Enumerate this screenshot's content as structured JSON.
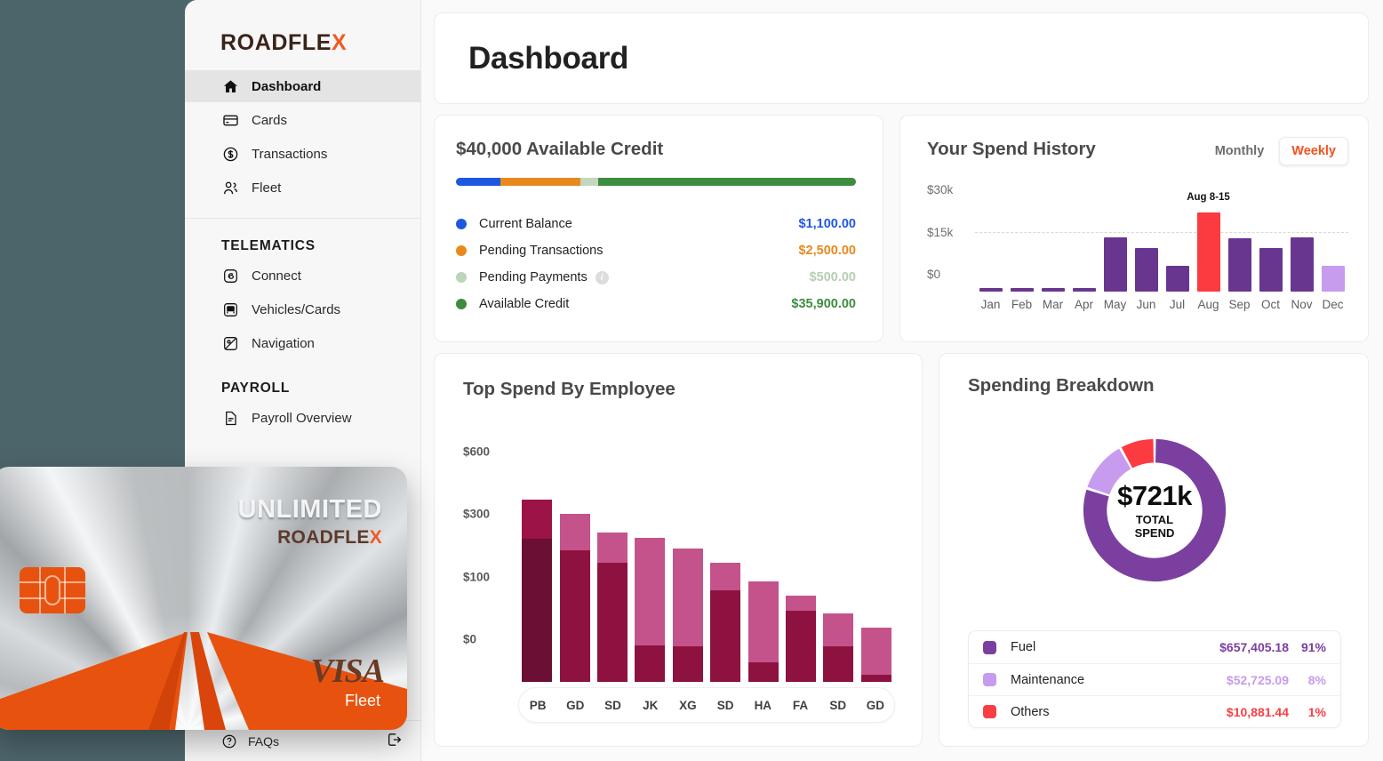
{
  "brand": {
    "name_main": "ROADFLE",
    "name_accent": "X",
    "accent_color": "#f05a22"
  },
  "sidebar": {
    "nav": [
      {
        "label": "Dashboard",
        "icon": "home-icon",
        "active": true
      },
      {
        "label": "Cards",
        "icon": "credit-card-icon",
        "active": false
      },
      {
        "label": "Transactions",
        "icon": "dollar-circle-icon",
        "active": false
      },
      {
        "label": "Fleet",
        "icon": "people-icon",
        "active": false
      }
    ],
    "groups": [
      {
        "title": "TELEMATICS",
        "items": [
          {
            "label": "Connect",
            "icon": "connect-icon"
          },
          {
            "label": "Vehicles/Cards",
            "icon": "bus-icon"
          },
          {
            "label": "Navigation",
            "icon": "navigation-icon"
          }
        ]
      },
      {
        "title": "PAYROLL",
        "items": [
          {
            "label": "Payroll Overview",
            "icon": "document-icon"
          }
        ]
      }
    ],
    "footer": {
      "faqs_label": "FAQs",
      "faqs_icon": "question-circle-icon",
      "logout_icon": "logout-icon"
    }
  },
  "header": {
    "title": "Dashboard"
  },
  "credit": {
    "title": "$40,000 Available Credit",
    "bar": [
      {
        "color": "#1f58e0",
        "pct": 11.0
      },
      {
        "color": "#e8891e",
        "pct": 20.0
      },
      {
        "color": "#c3d6c0",
        "pct": 4.5
      },
      {
        "color": "#3e8c3f",
        "pct": 64.5
      }
    ],
    "rows": [
      {
        "label": "Current Balance",
        "amount": "$1,100.00",
        "color": "#1f58e0",
        "info": false
      },
      {
        "label": "Pending Transactions",
        "amount": "$2,500.00",
        "color": "#e8891e",
        "info": false
      },
      {
        "label": "Pending Payments",
        "amount": "$500.00",
        "color": "#bcd4b8",
        "info": true
      },
      {
        "label": "Available Credit",
        "amount": "$35,900.00",
        "color": "#3e8c3f",
        "info": false
      }
    ]
  },
  "spend_history": {
    "title": "Your Spend History",
    "toggle": {
      "monthly": "Monthly",
      "weekly": "Weekly",
      "selected": "Weekly"
    }
  },
  "employee_spend": {
    "title": "Top Spend By Employee"
  },
  "breakdown": {
    "title": "Spending Breakdown",
    "total": "$721k",
    "total_label_line1": "TOTAL",
    "total_label_line2": "SPEND",
    "legend": [
      {
        "label": "Fuel",
        "amount": "$657,405.18",
        "pct": "91%",
        "color": "#7b3fa0"
      },
      {
        "label": "Maintenance",
        "amount": "$52,725.09",
        "pct": "8%",
        "color": "#c79bee"
      },
      {
        "label": "Others",
        "amount": "$10,881.44",
        "pct": "1%",
        "color": "#f93f43"
      }
    ]
  },
  "visa_card": {
    "unlimited": "UNLIMITED",
    "brand_main": "ROADFLE",
    "brand_accent": "X",
    "network": "VISA",
    "product": "Fleet"
  },
  "chart_data": [
    {
      "type": "bar",
      "title": "Your Spend History",
      "xlabel": "",
      "ylabel": "",
      "ylim": [
        0,
        33000
      ],
      "yticks": [
        0,
        15000,
        30000
      ],
      "ytick_labels": [
        "$0",
        "$15k",
        "$30k"
      ],
      "grid": true,
      "categories": [
        "Jan",
        "Feb",
        "Mar",
        "Apr",
        "May",
        "Jun",
        "Jul",
        "Aug",
        "Sep",
        "Oct",
        "Nov",
        "Dec"
      ],
      "values": [
        400,
        400,
        400,
        400,
        21000,
        17000,
        10000,
        30500,
        20500,
        17000,
        21000,
        10000
      ],
      "colors": [
        "#68368f",
        "#68368f",
        "#68368f",
        "#68368f",
        "#68368f",
        "#68368f",
        "#68368f",
        "#fb3b3f",
        "#68368f",
        "#68368f",
        "#68368f",
        "#c79bee"
      ],
      "annotation": {
        "category": "Aug",
        "text": "Aug 8-15"
      }
    },
    {
      "type": "bar",
      "title": "Top Spend By Employee",
      "stacked": true,
      "xlabel": "",
      "ylabel": "",
      "ylim": [
        0,
        640
      ],
      "yticks": [
        0,
        100,
        300,
        600
      ],
      "ytick_labels": [
        "$0",
        "$100",
        "$300",
        "$600"
      ],
      "grid": false,
      "categories": [
        "PB",
        "GD",
        "SD",
        "JK",
        "XG",
        "SD",
        "HA",
        "FA",
        "SD",
        "GD"
      ],
      "series": [
        {
          "name": "lower",
          "color": "#8e1240",
          "values": [
            390,
            335,
            283,
            58,
            57,
            193,
            32,
            128,
            57,
            12
          ]
        },
        {
          "name": "upper",
          "color": "#c4538b",
          "values": [
            190,
            175,
            135,
            335,
            285,
            90,
            190,
            48,
            63,
            75
          ]
        }
      ],
      "totals": [
        580,
        510,
        418,
        393,
        342,
        283,
        222,
        176,
        120,
        87
      ],
      "first_bar_color_override": "#6b0f34"
    },
    {
      "type": "pie",
      "title": "Spending Breakdown",
      "donut": true,
      "center_value": "$721k",
      "center_label": "TOTAL SPEND",
      "labels": [
        "Fuel",
        "Maintenance",
        "Others"
      ],
      "values": [
        657405.18,
        52725.09,
        10881.44
      ],
      "percentages": [
        91,
        8,
        1
      ],
      "display_shares": [
        80,
        12,
        8
      ],
      "colors": [
        "#7b3fa0",
        "#c79bee",
        "#fb3b3f"
      ],
      "legend_position": "bottom"
    }
  ]
}
